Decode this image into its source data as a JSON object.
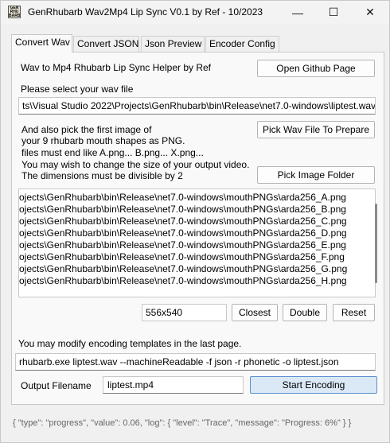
{
  "window": {
    "title": "GenRhubarb Wav2Mp4 Lip Sync V0.1 by Ref - 10/2023",
    "icon_text": "GEN\nRHU\nBARB",
    "controls": {
      "minimize": "—",
      "maximize": "☐",
      "close": "✕"
    }
  },
  "tabs": [
    {
      "label": "Convert Wav",
      "active": true
    },
    {
      "label": "Convert JSON",
      "active": false
    },
    {
      "label": "Json Preview",
      "active": false
    },
    {
      "label": "Encoder Config",
      "active": false
    }
  ],
  "convert_wav": {
    "header_text": "Wav to Mp4 Rhubarb Lip Sync Helper by Ref",
    "open_github_button": "Open Github Page",
    "select_wav_label": "Please select your wav file",
    "wav_path": "ts\\Visual Studio 2022\\Projects\\GenRhubarb\\bin\\Release\\net7.0-windows\\liptest.wav",
    "pick_wav_button": "Pick Wav File To Prepare",
    "instructions": [
      "And also pick the first image of",
      "your 9 rhubarb mouth shapes as PNG.",
      "files must end like A.png... B.png... X.png...",
      "You may wish to change the size of your output video.",
      "The dimensions must be divisible by 2"
    ],
    "pick_image_button": "Pick Image Folder",
    "image_files": [
      "ojects\\GenRhubarb\\bin\\Release\\net7.0-windows\\mouthPNGs\\arda256_A.png",
      "ojects\\GenRhubarb\\bin\\Release\\net7.0-windows\\mouthPNGs\\arda256_B.png",
      "ojects\\GenRhubarb\\bin\\Release\\net7.0-windows\\mouthPNGs\\arda256_C.png",
      "ojects\\GenRhubarb\\bin\\Release\\net7.0-windows\\mouthPNGs\\arda256_D.png",
      "ojects\\GenRhubarb\\bin\\Release\\net7.0-windows\\mouthPNGs\\arda256_E.png",
      "ojects\\GenRhubarb\\bin\\Release\\net7.0-windows\\mouthPNGs\\arda256_F.png",
      "ojects\\GenRhubarb\\bin\\Release\\net7.0-windows\\mouthPNGs\\arda256_G.png",
      "ojects\\GenRhubarb\\bin\\Release\\net7.0-windows\\mouthPNGs\\arda256_H.png"
    ],
    "size_value": "556x540",
    "closest_button": "Closest",
    "double_button": "Double",
    "reset_button": "Reset",
    "templates_note": "You may modify encoding templates in the last page.",
    "command_line": "rhubarb.exe liptest.wav --machineReadable -f json -r phonetic -o liptest.json",
    "output_filename_label": "Output Filename",
    "output_filename": "liptest.mp4",
    "start_encoding_button": "Start Encoding"
  },
  "status": {
    "text": "{ \"type\": \"progress\", \"value\": 0.06, \"log\": { \"level\": \"Trace\", \"message\": \"Progress: 6%\" } }"
  }
}
